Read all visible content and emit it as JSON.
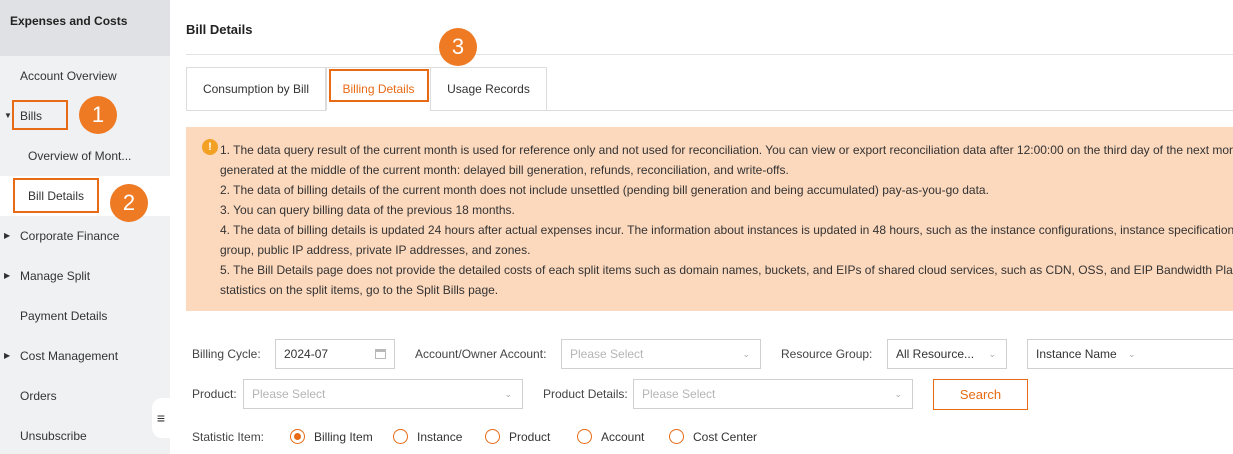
{
  "sidebar": {
    "header": "Expenses and Costs",
    "items": [
      {
        "label": "Account Overview"
      },
      {
        "label": "Bills"
      },
      {
        "label": "Overview of Mont..."
      },
      {
        "label": "Bill Details"
      },
      {
        "label": "Corporate Finance"
      },
      {
        "label": "Manage Split"
      },
      {
        "label": "Payment Details"
      },
      {
        "label": "Cost Management"
      },
      {
        "label": "Orders"
      },
      {
        "label": "Unsubscribe"
      }
    ],
    "collapse_icon": "collapse-icon",
    "collapse_glyph": "≡"
  },
  "page": {
    "title": "Bill Details"
  },
  "tabs": [
    {
      "label": "Consumption by Bill"
    },
    {
      "label": "Billing Details",
      "active": true
    },
    {
      "label": "Usage Records"
    }
  ],
  "notice": {
    "icon": "info-icon",
    "icon_glyph": "!",
    "lines": [
      "1. The data query result of the current month is used for reference only and not used for reconciliation. You can view or export reconciliation data after 12:00:00 on the third day of the next mon",
      "generated at the middle of the current month: delayed bill generation, refunds, reconciliation, and write-offs.",
      "2. The data of billing details of the current month does not include unsettled (pending bill generation and being accumulated) pay-as-you-go data.",
      "3. You can query billing data of the previous 18 months.",
      "4. The data of billing details is updated 24 hours after actual expenses incur. The information about instances is updated in 48 hours, such as the instance configurations, instance specification",
      "group, public IP address, private IP addresses, and zones.",
      "5. The Bill Details page does not provide the detailed costs of each split items such as domain names, buckets, and EIPs of shared cloud services, such as CDN, OSS, and EIP Bandwidth Pla",
      "statistics on the split items, go to the Split Bills page."
    ]
  },
  "filters": {
    "billing_cycle_label": "Billing Cycle:",
    "billing_cycle_value": "2024-07",
    "calendar_icon": "calendar-icon",
    "account_label": "Account/Owner Account:",
    "account_placeholder": "Please Select",
    "resource_group_label": "Resource Group:",
    "resource_group_value": "All Resource...",
    "instance_name_value": "Instance Name",
    "product_label": "Product:",
    "product_placeholder": "Please Select",
    "product_details_label": "Product Details:",
    "product_details_placeholder": "Please Select",
    "search_label": "Search",
    "chevron_glyph": "⌄"
  },
  "statistic": {
    "label": "Statistic Item:",
    "options": [
      {
        "label": "Billing Item",
        "checked": true
      },
      {
        "label": "Instance"
      },
      {
        "label": "Product"
      },
      {
        "label": "Account"
      },
      {
        "label": "Cost Center"
      }
    ]
  },
  "callouts": [
    "1",
    "2",
    "3"
  ],
  "colors": {
    "accent": "#e86a14",
    "notice_bg": "#fcd8bd",
    "sidebar_bg": "#f0f1f3",
    "badge": "#ee7a24"
  }
}
